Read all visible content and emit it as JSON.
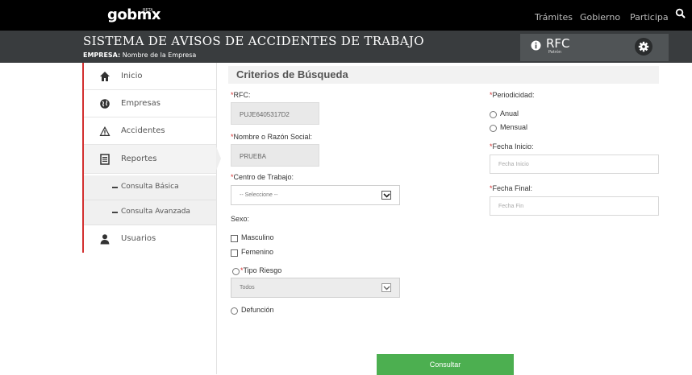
{
  "topnav": {
    "logo_gob": "gob",
    "logo_mx": "mx",
    "logo_beta": "BETA",
    "links": [
      "Trámites",
      "Gobierno",
      "Participa"
    ],
    "search_icon": "search-icon"
  },
  "header": {
    "title": "SISTEMA DE AVISOS DE ACCIDENTES DE TRABAJO",
    "empresa_label": "EMPRESA:",
    "empresa_value": "Nombre de la Empresa",
    "rfc_label": "RFC",
    "rfc_sub": "Patrón",
    "settings_icon": "gear-icon"
  },
  "sidebar": {
    "items": [
      {
        "label": "Inicio",
        "icon": "home-icon"
      },
      {
        "label": "Empresas",
        "icon": "globe-icon"
      },
      {
        "label": "Accidentes",
        "icon": "warning-icon"
      },
      {
        "label": "Reportes",
        "icon": "report-icon"
      },
      {
        "label": "Usuarios",
        "icon": "user-icon"
      }
    ],
    "subitems": [
      "Consulta Básica",
      "Consulta Avanzada"
    ]
  },
  "main": {
    "section_title": "Criterios de Búsqueda",
    "rfc": {
      "label": "RFC:",
      "value": "PUJE6405317D2"
    },
    "nombre": {
      "label": "Nombre o Razón Social:",
      "value": "PRUEBA"
    },
    "centro": {
      "label": "Centro de Trabajo:",
      "value": "-- Seleccione --"
    },
    "sexo": {
      "label": "Sexo:",
      "options": [
        "Masculino",
        "Femenino"
      ]
    },
    "tipo_riesgo": {
      "label": "Tipo Riesgo",
      "value": "Todos"
    },
    "defuncion_label": "Defunción",
    "periodicidad": {
      "label": "Periodicidad:",
      "options": [
        "Anual",
        "Mensual"
      ]
    },
    "fecha_inicio": {
      "label": "Fecha Inicio:",
      "placeholder": "Fecha Inicio"
    },
    "fecha_final": {
      "label": "Fecha Final:",
      "placeholder": "Fecha Fin"
    },
    "submit_label": "Consultar"
  },
  "colors": {
    "nav_bg": "#000000",
    "header_bg": "#393c3e",
    "accent_red": "#d32f2f",
    "button_green": "#4caf50"
  }
}
